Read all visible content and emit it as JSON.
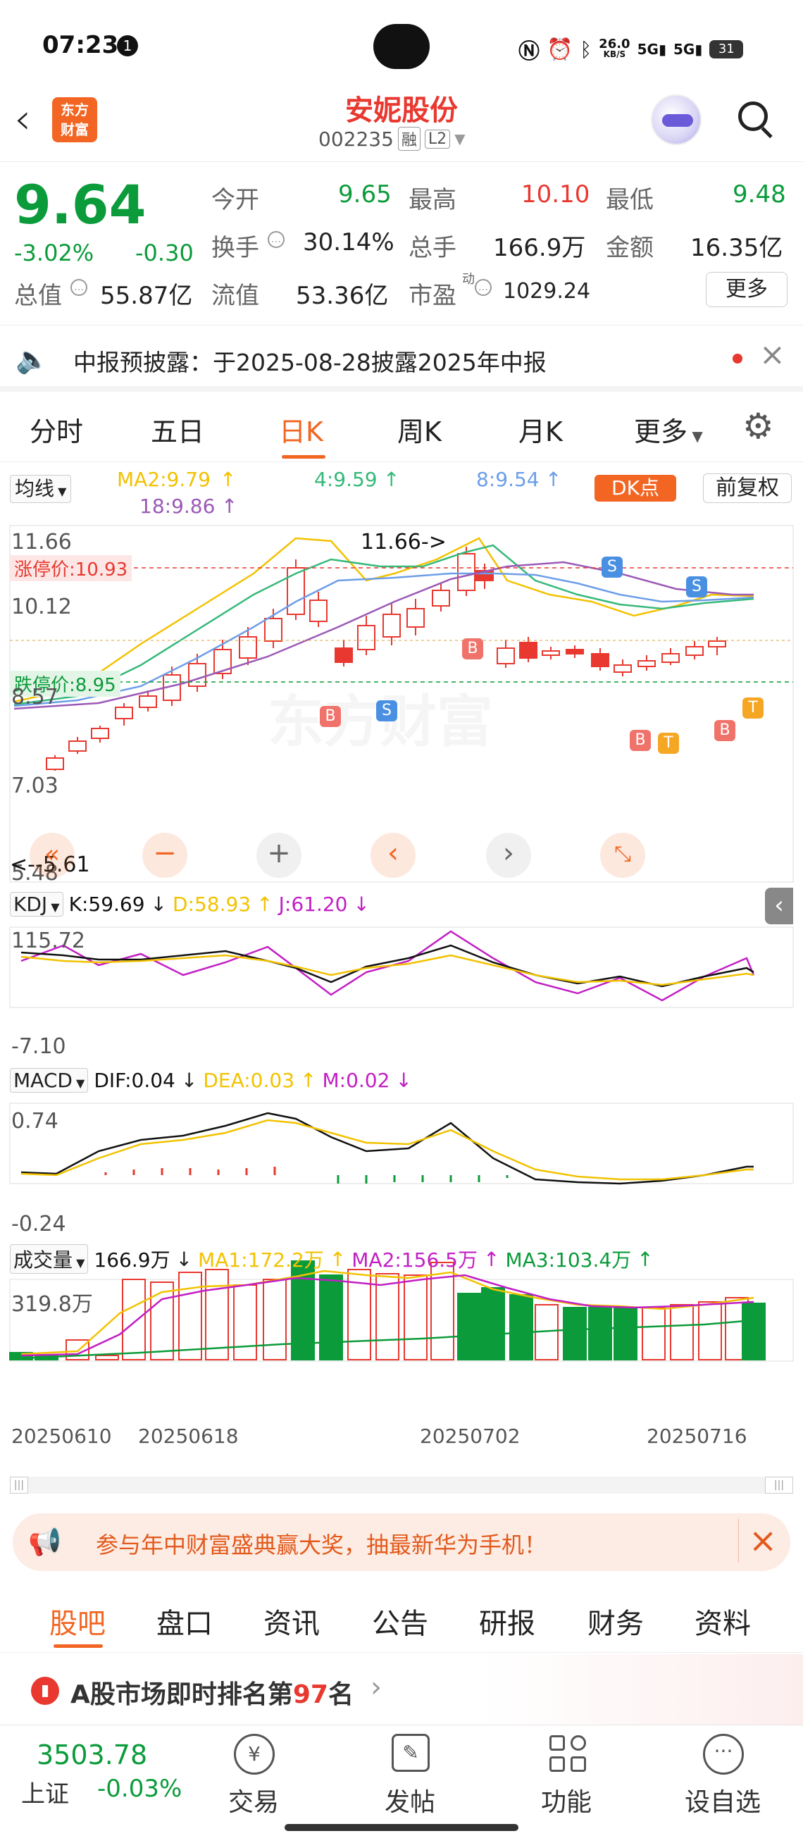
{
  "status_bar": {
    "time": "07:23",
    "notif_count": "1",
    "speed": "26.0",
    "speed_unit": "KB/S",
    "net1": "5G",
    "net2": "5G",
    "battery": "31"
  },
  "header": {
    "logo_line1": "东方",
    "logo_line2": "财富",
    "stock_name": "安妮股份",
    "stock_code": "002235",
    "tag_margin": "融",
    "tag_level": "L2"
  },
  "quote": {
    "price": "9.64",
    "change_pct": "-3.02%",
    "change": "-0.30",
    "open_label": "今开",
    "open": "9.65",
    "high_label": "最高",
    "high": "10.10",
    "low_label": "最低",
    "low": "9.48",
    "turnover_label": "换手",
    "turnover": "30.14%",
    "volume_label": "总手",
    "volume": "166.9万",
    "amount_label": "金额",
    "amount": "16.35亿",
    "mcap_label": "总值",
    "mcap": "55.87亿",
    "float_label": "流值",
    "float_mcap": "53.36亿",
    "pe_label": "市盈",
    "pe_sup": "动",
    "pe": "1029.24",
    "more_button": "更多"
  },
  "notice": {
    "text": "中报预披露：于2025-08-28披露2025年中报"
  },
  "chart_tabs": {
    "items": [
      "分时",
      "五日",
      "日K",
      "周K",
      "月K",
      "更多"
    ],
    "active": "日K"
  },
  "kline": {
    "indicator": "均线",
    "ma2": "MA2:9.79",
    "ma4": "4:9.59",
    "ma8": "8:9.54",
    "ma18": "18:9.86",
    "dk_button": "DK点",
    "adjust_button": "前复权",
    "y_labels": [
      "11.66",
      "10.12",
      "8.57",
      "7.03",
      "5.48"
    ],
    "limit_up": "涨停价:10.93",
    "limit_down": "跌停价:8.95",
    "max_label": "11.66->",
    "min_label": "<--5.61",
    "watermark": "东方财富"
  },
  "kdj": {
    "name": "KDJ",
    "k": "K:59.69",
    "d": "D:58.93",
    "j": "J:61.20",
    "y_top": "115.72",
    "y_bottom": "-7.10"
  },
  "macd": {
    "name": "MACD",
    "dif": "DIF:0.04",
    "dea": "DEA:0.03",
    "m": "M:0.02",
    "y_top": "0.74",
    "y_bottom": "-0.24"
  },
  "volume": {
    "name": "成交量",
    "value": "166.9万",
    "ma1": "MA1:172.2万",
    "ma2": "MA2:156.5万",
    "ma3": "MA3:103.4万",
    "y_top": "319.8万"
  },
  "dates": [
    "20250610",
    "20250618",
    "20250702",
    "20250716"
  ],
  "ad": {
    "text": "参与年中财富盛典赢大奖，抽最新华为手机！"
  },
  "bottom_tabs": {
    "items": [
      "股吧",
      "盘口",
      "资讯",
      "公告",
      "研报",
      "财务",
      "资料"
    ],
    "active": "股吧"
  },
  "rank": {
    "prefix": "A股市场即时排名第",
    "number": "97",
    "suffix": "名"
  },
  "index": {
    "value": "3503.78",
    "name": "上证",
    "change": "-0.03%"
  },
  "bottom_nav": {
    "trade": "交易",
    "post": "发帖",
    "func": "功能",
    "watch": "设自选"
  },
  "chart_data": {
    "type": "candlestick",
    "dates": [
      "20250610",
      "20250618",
      "20250702",
      "20250716"
    ],
    "y_axis": [
      5.48,
      11.66
    ],
    "limit_up": 10.93,
    "limit_down": 8.95,
    "kline_max": 11.66,
    "kline_min": 5.61,
    "last": {
      "open": 9.65,
      "high": 10.1,
      "low": 9.48,
      "close": 9.64
    },
    "ma": {
      "MA2": 9.79,
      "MA4": 9.59,
      "MA8": 9.54,
      "MA18": 9.86
    },
    "kdj": {
      "K": 59.69,
      "D": 58.93,
      "J": 61.2,
      "range": [
        -7.1,
        115.72
      ]
    },
    "macd": {
      "DIF": 0.04,
      "DEA": 0.03,
      "M": 0.02,
      "range": [
        -0.24,
        0.74
      ]
    },
    "volume": {
      "last": "166.9万",
      "MA1": "172.2万",
      "MA2": "156.5万",
      "MA3": "103.4万",
      "max": "319.8万"
    },
    "colors": {
      "up": "#e8382f",
      "down": "#0b9b3a",
      "ma2": "#f2c200",
      "ma4": "#36b97a",
      "ma8": "#6d9ee8",
      "ma18": "#9b59b6",
      "accent": "#f26522"
    }
  }
}
